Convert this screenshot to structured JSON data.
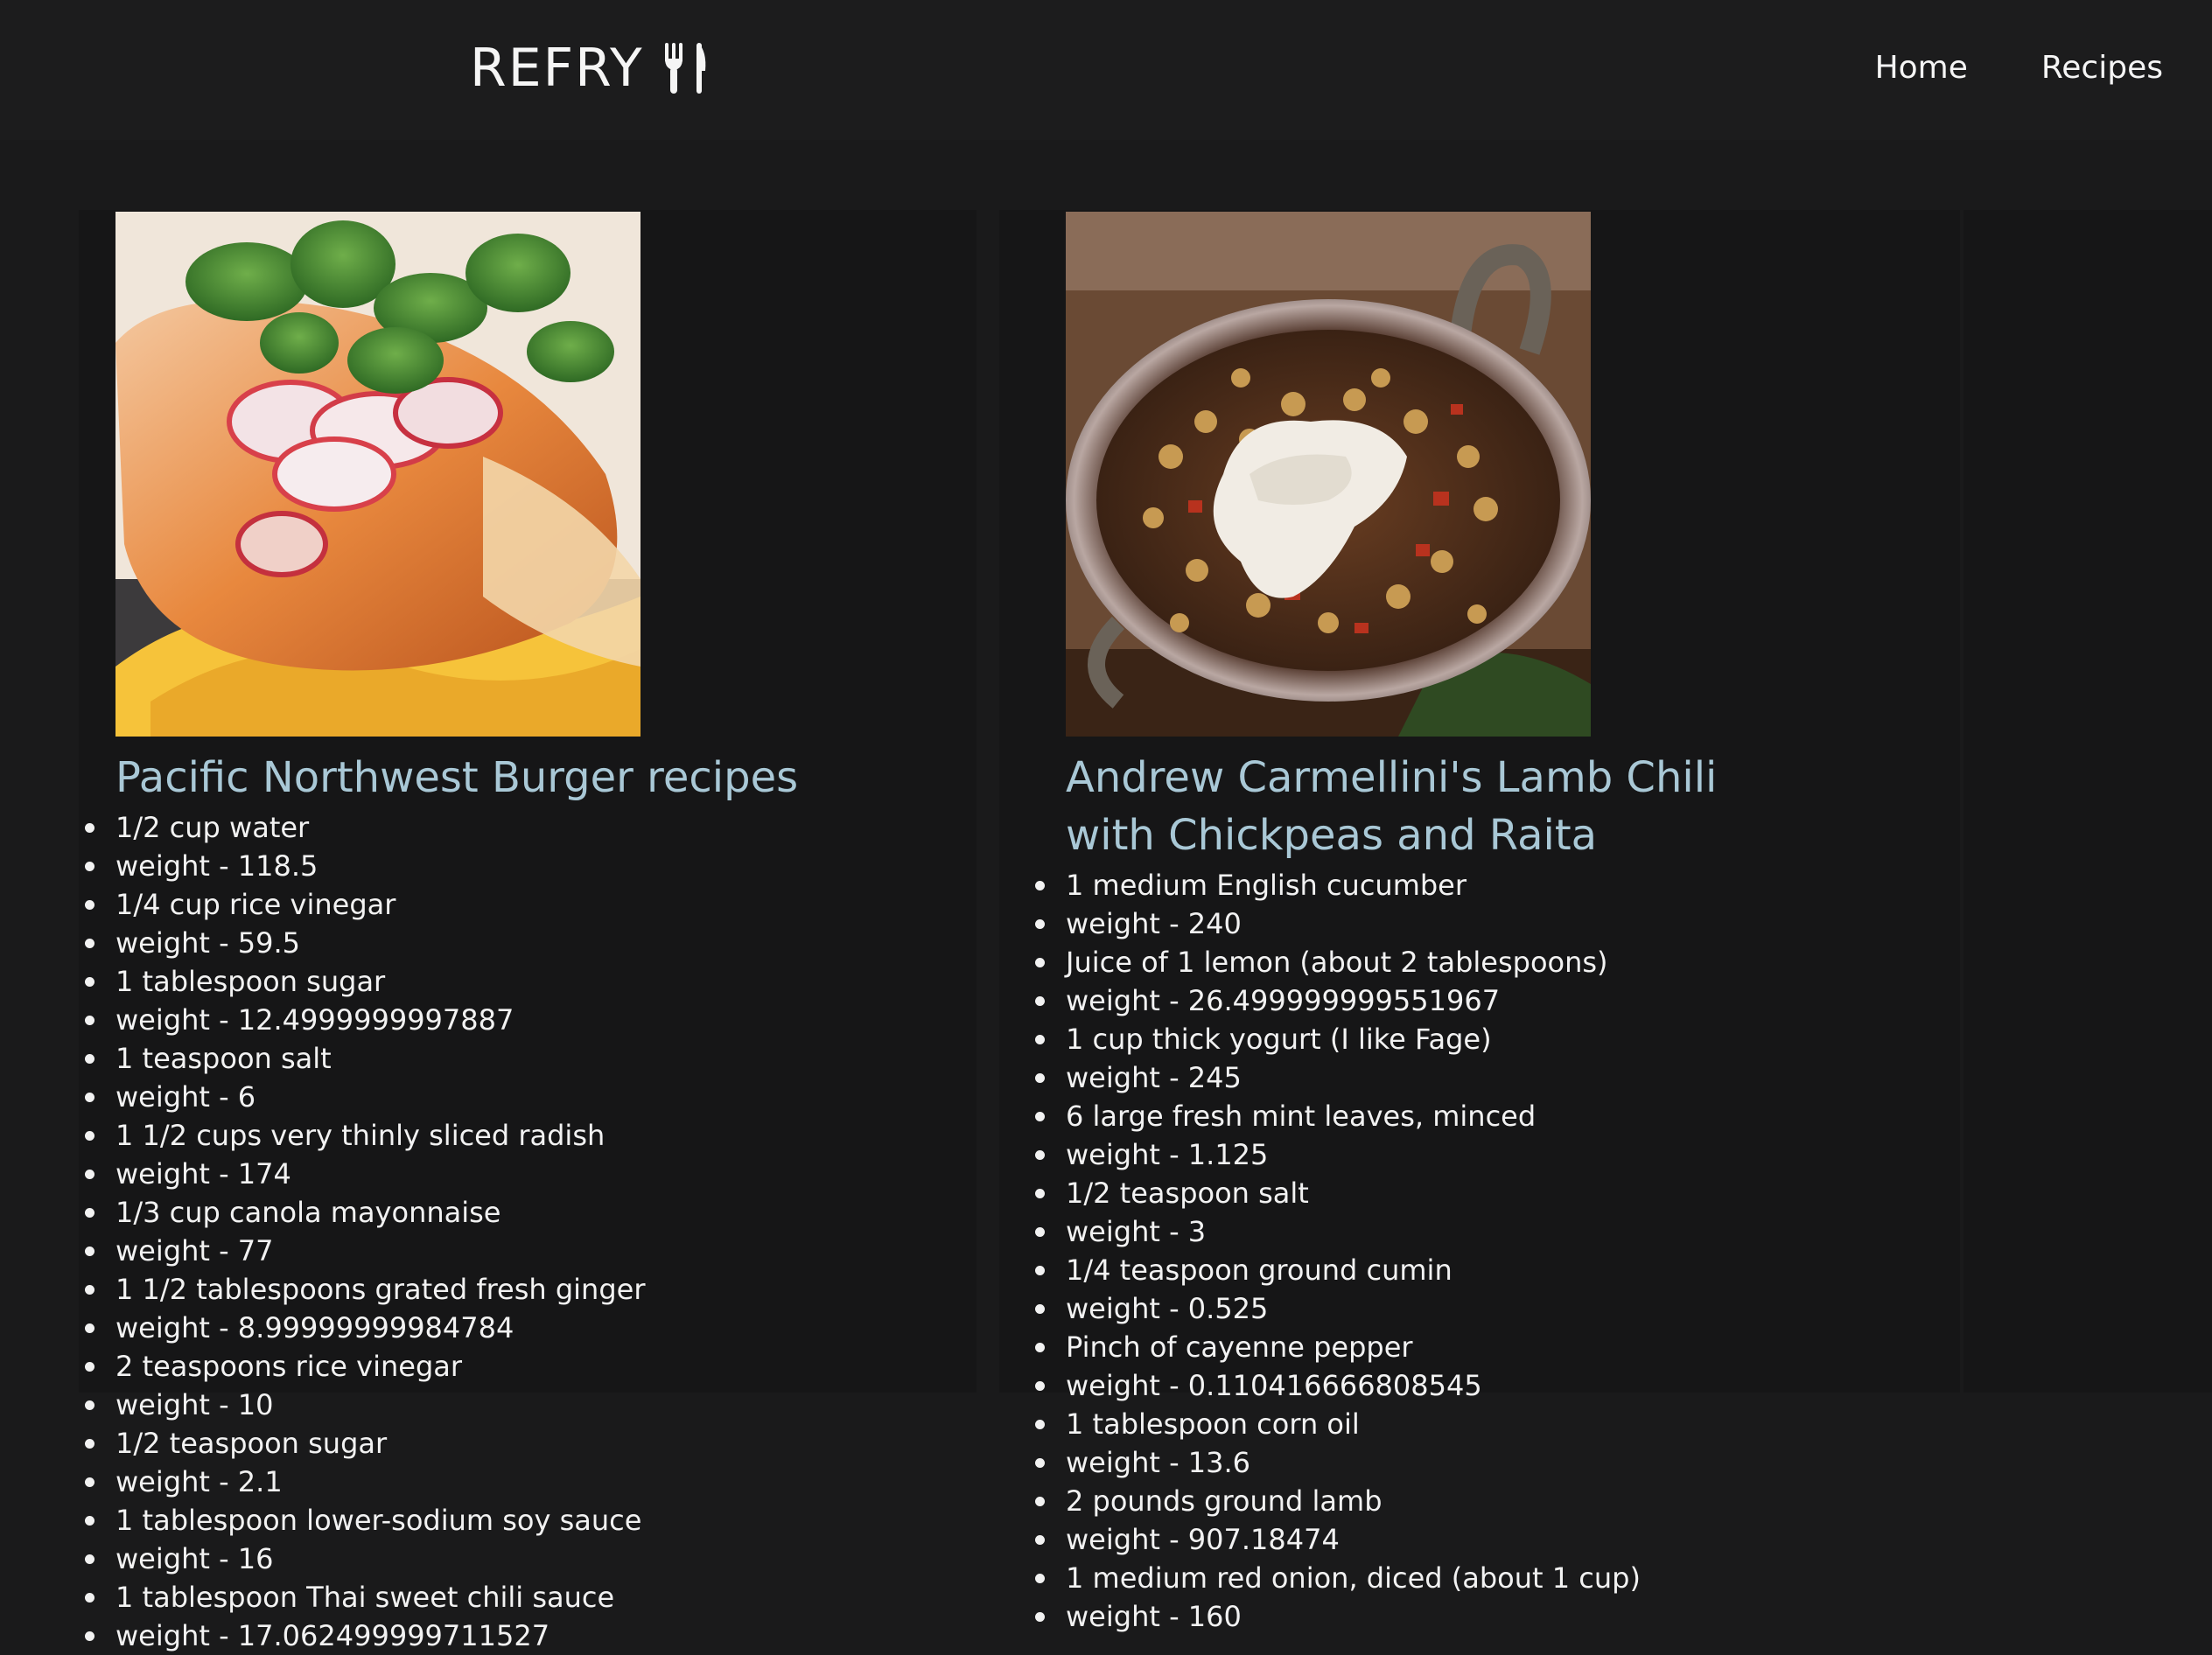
{
  "header": {
    "brand": "REFRY",
    "nav": [
      "Home",
      "Recipes"
    ]
  },
  "recipes": [
    {
      "title": "Pacific Northwest Burger recipes",
      "image": "burger-photo",
      "ingredients": [
        "1/2 cup water",
        "weight - 118.5",
        "1/4 cup rice vinegar",
        "weight - 59.5",
        "1 tablespoon sugar",
        "weight - 12.4999999997887",
        "1 teaspoon salt",
        "weight - 6",
        "1 1/2 cups very thinly sliced radish",
        "weight - 174",
        "1/3 cup canola mayonnaise",
        "weight - 77",
        "1 1/2 tablespoons grated fresh ginger",
        "weight - 8.99999999984784",
        "2 teaspoons rice vinegar",
        "weight - 10",
        "1/2 teaspoon sugar",
        "weight - 2.1",
        "1 tablespoon lower-sodium soy sauce",
        "weight - 16",
        "1 tablespoon Thai sweet chili sauce",
        "weight - 17.062499999711527"
      ]
    },
    {
      "title": "Andrew Carmellini's Lamb Chili with Chickpeas and Raita",
      "image": "lamb-chili-photo",
      "ingredients": [
        "1 medium English cucumber",
        "weight - 240",
        "Juice of 1 lemon (about 2 tablespoons)",
        "weight - 26.499999999551967",
        "1 cup thick yogurt (I like Fage)",
        "weight - 245",
        "6 large fresh mint leaves, minced",
        "weight - 1.125",
        "1/2 teaspoon salt",
        "weight - 3",
        "1/4 teaspoon ground cumin",
        "weight - 0.525",
        "Pinch of cayenne pepper",
        "weight - 0.110416666808545",
        "1 tablespoon corn oil",
        "weight - 13.6",
        "2 pounds ground lamb",
        "weight - 907.18474",
        "1 medium red onion, diced (about 1 cup)",
        "weight - 160"
      ]
    }
  ]
}
